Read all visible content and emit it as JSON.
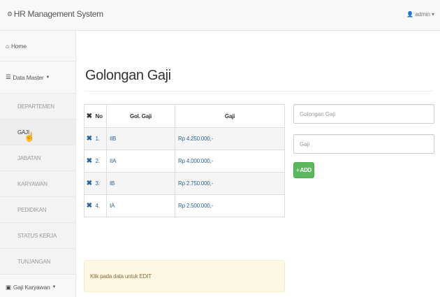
{
  "app": {
    "title": "HR Management System",
    "brand_icon": "cogs-icon"
  },
  "user": {
    "name": "admin"
  },
  "sidebar": {
    "home_label": "Home",
    "master_label": "Data Master",
    "items": [
      {
        "label": "DEPARTEMEN",
        "active": false
      },
      {
        "label": "GAJI",
        "active": true
      },
      {
        "label": "JABATAN",
        "active": false
      },
      {
        "label": "KARYAWAN",
        "active": false
      },
      {
        "label": "PEDIDIKAN",
        "active": false
      },
      {
        "label": "STATUS KERJA",
        "active": false
      },
      {
        "label": "TUNJANGAN",
        "active": false
      }
    ],
    "gaji_karyawan_label": "Gaji Karyawan"
  },
  "main": {
    "title": "Golongan Gaji",
    "table": {
      "headers": {
        "no": "No",
        "gol": "Gol. Gaji",
        "gaji": "Gaji"
      },
      "rows": [
        {
          "no": "1.",
          "gol": "IIB",
          "gaji": "Rp 4.250.000,-"
        },
        {
          "no": "2.",
          "gol": "IIA",
          "gaji": "Rp 4.000.000,-"
        },
        {
          "no": "3.",
          "gol": "IB",
          "gaji": "Rp 2.750.000,-"
        },
        {
          "no": "4.",
          "gol": "IA",
          "gaji": "Rp 2.500.000,-"
        }
      ]
    },
    "alert": "Klik pada data untuk EDIT"
  },
  "form": {
    "golongan_placeholder": "Golongan Gaji",
    "gaji_placeholder": "Gaji",
    "add_label": "ADD"
  },
  "colors": {
    "accent": "#5cb85c",
    "link": "#2a6496",
    "alert_bg": "#fcf8e3"
  }
}
